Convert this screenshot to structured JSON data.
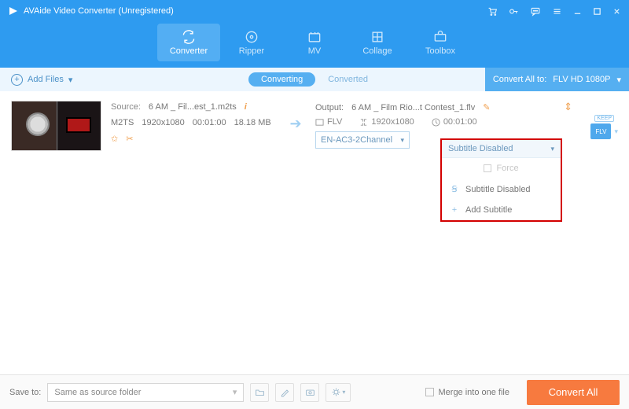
{
  "titlebar": {
    "app_title": "AVAide Video Converter (Unregistered)"
  },
  "toolbar": {
    "items": [
      {
        "label": "Converter"
      },
      {
        "label": "Ripper"
      },
      {
        "label": "MV"
      },
      {
        "label": "Collage"
      },
      {
        "label": "Toolbox"
      }
    ]
  },
  "subbar": {
    "add_files": "Add Files",
    "converting": "Converting",
    "converted": "Converted",
    "convert_all_to": "Convert All to:",
    "format": "FLV HD 1080P"
  },
  "item": {
    "source_label": "Source:",
    "source_name": "6 AM _ Fil...est_1.m2ts",
    "container": "M2TS",
    "resolution": "1920x1080",
    "duration": "00:01:00",
    "size": "18.18 MB",
    "output_label": "Output:",
    "output_name": "6 AM _ Film Rio...t Contest_1.flv",
    "out_container": "FLV",
    "out_resolution": "1920x1080",
    "out_duration": "00:01:00",
    "audio_select": "EN-AC3-2Channel",
    "subtitle_select": "Subtitle Disabled",
    "badge_keep": "KEEP",
    "badge_flv": "FLV"
  },
  "dropdown": {
    "header": "Subtitle Disabled",
    "force": "Force",
    "opt_disabled": "Subtitle Disabled",
    "opt_add": "Add Subtitle"
  },
  "bottom": {
    "save_to": "Save to:",
    "folder": "Same as source folder",
    "merge": "Merge into one file",
    "convert_all": "Convert All"
  }
}
